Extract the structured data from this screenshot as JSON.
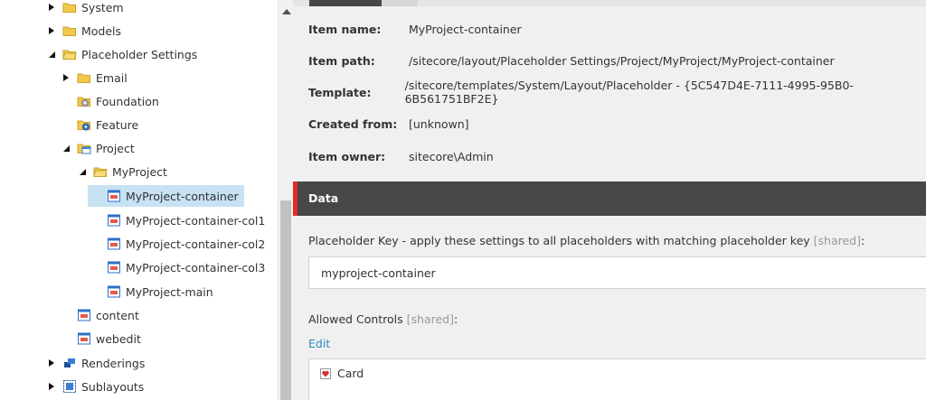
{
  "tree": {
    "nodes": [
      {
        "label": "System",
        "expander": "collapsed",
        "icon": "folder"
      },
      {
        "label": "Models",
        "expander": "collapsed",
        "icon": "folder"
      },
      {
        "label": "Placeholder Settings",
        "expander": "expanded",
        "icon": "folder"
      },
      {
        "label": "Email",
        "expander": "collapsed",
        "icon": "folder"
      },
      {
        "label": "Foundation",
        "expander": "none",
        "icon": "folder-gear"
      },
      {
        "label": "Feature",
        "expander": "none",
        "icon": "folder-gear-blue"
      },
      {
        "label": "Project",
        "expander": "expanded",
        "icon": "folder-window"
      },
      {
        "label": "MyProject",
        "expander": "expanded",
        "icon": "folder"
      },
      {
        "label": "MyProject-container",
        "expander": "none",
        "icon": "placeholder",
        "selected": true
      },
      {
        "label": "MyProject-container-col1",
        "expander": "none",
        "icon": "placeholder"
      },
      {
        "label": "MyProject-container-col2",
        "expander": "none",
        "icon": "placeholder"
      },
      {
        "label": "MyProject-container-col3",
        "expander": "none",
        "icon": "placeholder"
      },
      {
        "label": "MyProject-main",
        "expander": "none",
        "icon": "placeholder"
      },
      {
        "label": "content",
        "expander": "none",
        "icon": "placeholder"
      },
      {
        "label": "webedit",
        "expander": "none",
        "icon": "placeholder"
      },
      {
        "label": "Renderings",
        "expander": "collapsed",
        "icon": "renderings"
      },
      {
        "label": "Sublayouts",
        "expander": "collapsed",
        "icon": "sublayouts"
      }
    ]
  },
  "info": [
    {
      "label": "Item name:",
      "value": "MyProject-container"
    },
    {
      "label": "Item path:",
      "value": "/sitecore/layout/Placeholder Settings/Project/MyProject/MyProject-container"
    },
    {
      "label": "Template:",
      "value": "/sitecore/templates/System/Layout/Placeholder - {5C547D4E-7111-4995-95B0-6B561751BF2E}"
    },
    {
      "label": "Created from:",
      "value": "[unknown]"
    },
    {
      "label": "Item owner:",
      "value": "sitecore\\Admin"
    }
  ],
  "data_section": {
    "title": "Data",
    "placeholder_key_label": "Placeholder Key - apply these settings to all placeholders with matching placeholder key",
    "shared_tag": "[shared]",
    "placeholder_key_value": "myproject-container",
    "allowed_controls_label": "Allowed Controls",
    "edit_label": "Edit",
    "allowed_controls": [
      "Card"
    ]
  },
  "colors": {
    "accent_red": "#e52b22",
    "header_dark": "#474747",
    "link_blue": "#2b8cc4",
    "selection": "#c7e2f3"
  }
}
